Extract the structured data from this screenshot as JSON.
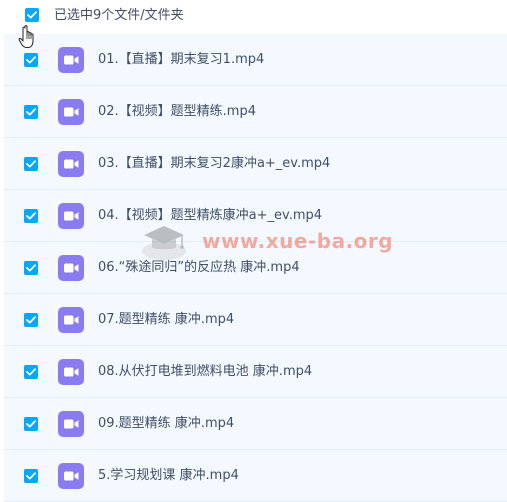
{
  "header": {
    "select_all_checked": true,
    "selection_text": "已选中9个文件/文件夹"
  },
  "files": [
    {
      "name": "01.【直播】期末复习1.mp4",
      "checked": true,
      "icon": "video-file-icon"
    },
    {
      "name": "02.【视频】题型精练.mp4",
      "checked": true,
      "icon": "video-file-icon"
    },
    {
      "name": "03.【直播】期末复习2康冲a+_ev.mp4",
      "checked": true,
      "icon": "video-file-icon"
    },
    {
      "name": "04.【视频】题型精炼康冲a+_ev.mp4",
      "checked": true,
      "icon": "video-file-icon"
    },
    {
      "name": "06.“殊途同归”的反应热 康冲.mp4",
      "checked": true,
      "icon": "video-file-icon"
    },
    {
      "name": "07.题型精练 康冲.mp4",
      "checked": true,
      "icon": "video-file-icon"
    },
    {
      "name": "08.从伏打电堆到燃料电池 康冲.mp4",
      "checked": true,
      "icon": "video-file-icon"
    },
    {
      "name": "09.题型精练 康冲.mp4",
      "checked": true,
      "icon": "video-file-icon"
    },
    {
      "name": "5.学习规划课 康冲.mp4",
      "checked": true,
      "icon": "video-file-icon"
    }
  ],
  "watermark": {
    "text": "www.xue-ba.org"
  },
  "colors": {
    "checkbox": "#06a7ff",
    "row_background": "#f3f9ff",
    "video_icon": "#8a7cf0",
    "text": "#424e67",
    "watermark": "#ee6a50"
  }
}
